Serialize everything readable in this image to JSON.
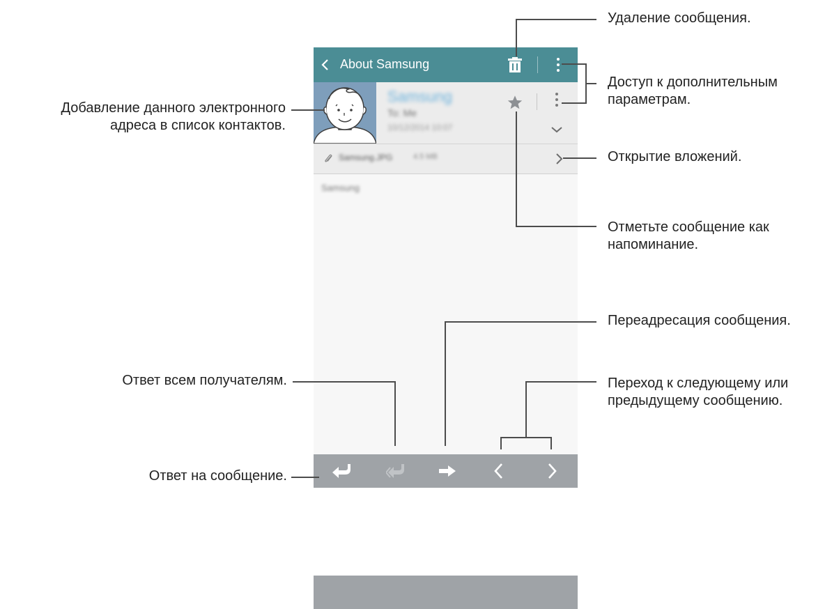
{
  "app_bar": {
    "title": "About Samsung",
    "back_icon": "chevron-left-icon",
    "delete_icon": "trash-icon",
    "more_icon": "more-vertical-icon"
  },
  "message": {
    "sender_name": "Samsung",
    "recipient": "To: Me",
    "date": "10/12/2014 10:07",
    "star_icon": "star-icon",
    "attachment": {
      "name": "Samsung.JPG",
      "size": "4.5 MB"
    },
    "body": "Samsung"
  },
  "bottom_bar": {
    "icons": [
      "reply-icon",
      "reply-all-icon",
      "forward-icon",
      "previous-icon",
      "next-icon"
    ]
  },
  "annotations": {
    "delete": "Удаление сообщения.",
    "more_options_line1": "Доступ к дополнительным",
    "more_options_line2": "параметрам.",
    "add_contact_line1": "Добавление данного электронного",
    "add_contact_line2": "адреса в список контактов.",
    "attachments": "Открытие вложений.",
    "reminder_line1": "Отметьте сообщение как",
    "reminder_line2": "напоминание.",
    "forward": "Переадресация сообщения.",
    "reply_all": "Ответ всем получателям.",
    "navigate_line1": "Переход к следующему или",
    "navigate_line2": "предыдущему сообщению.",
    "reply": "Ответ на сообщение."
  },
  "colors": {
    "app_bar": "#4b8d95",
    "avatar": "#7e9ebb",
    "bottom_bar": "#9fa3a7",
    "sender_name": "#6fb4dd"
  }
}
